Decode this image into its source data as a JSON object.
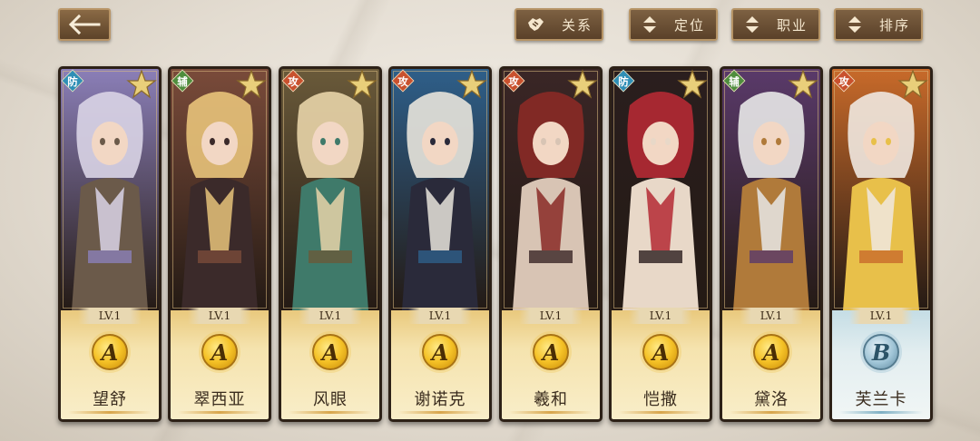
{
  "toolbar": {
    "relation_label": "关系",
    "position_label": "定位",
    "class_label": "职业",
    "sort_label": "排序"
  },
  "colors": {
    "defense": "#2f8fb6",
    "support": "#4f8e3e",
    "attack": "#c9512e",
    "gold": "#f5c227",
    "frame": "#5d4329"
  },
  "cards": [
    {
      "role": "防",
      "role_type": "defense",
      "level": "LV.1",
      "rank": "A",
      "name": "望舒",
      "theme": [
        "#8b7fb8",
        "#d9d4e6",
        "#6b5a4a"
      ]
    },
    {
      "role": "辅",
      "role_type": "support",
      "level": "LV.1",
      "rank": "A",
      "name": "翠西亚",
      "theme": [
        "#7a4b3a",
        "#e8c37a",
        "#3b2a2a"
      ]
    },
    {
      "role": "攻",
      "role_type": "attack",
      "level": "LV.1",
      "rank": "A",
      "name": "风眼",
      "theme": [
        "#6a5a3a",
        "#e8d4a8",
        "#3f7a6a"
      ]
    },
    {
      "role": "攻",
      "role_type": "attack",
      "level": "LV.1",
      "rank": "A",
      "name": "谢诺克",
      "theme": [
        "#2e5f8a",
        "#e8e4dc",
        "#2a2a3a"
      ]
    },
    {
      "role": "攻",
      "role_type": "attack",
      "level": "LV.1",
      "rank": "A",
      "name": "羲和",
      "theme": [
        "#3a2626",
        "#8a2a26",
        "#d8c4b4"
      ]
    },
    {
      "role": "防",
      "role_type": "defense",
      "level": "LV.1",
      "rank": "A",
      "name": "恺撒",
      "theme": [
        "#2a1e1e",
        "#b42a34",
        "#e8d8c8"
      ]
    },
    {
      "role": "辅",
      "role_type": "support",
      "level": "LV.1",
      "rank": "A",
      "name": "黛洛",
      "theme": [
        "#5a3a6a",
        "#e8e8e8",
        "#b07a3a"
      ]
    },
    {
      "role": "攻",
      "role_type": "attack",
      "level": "LV.1",
      "rank": "B",
      "name": "芙兰卡",
      "theme": [
        "#c86a2a",
        "#f0e8e0",
        "#e8c04a"
      ]
    }
  ]
}
